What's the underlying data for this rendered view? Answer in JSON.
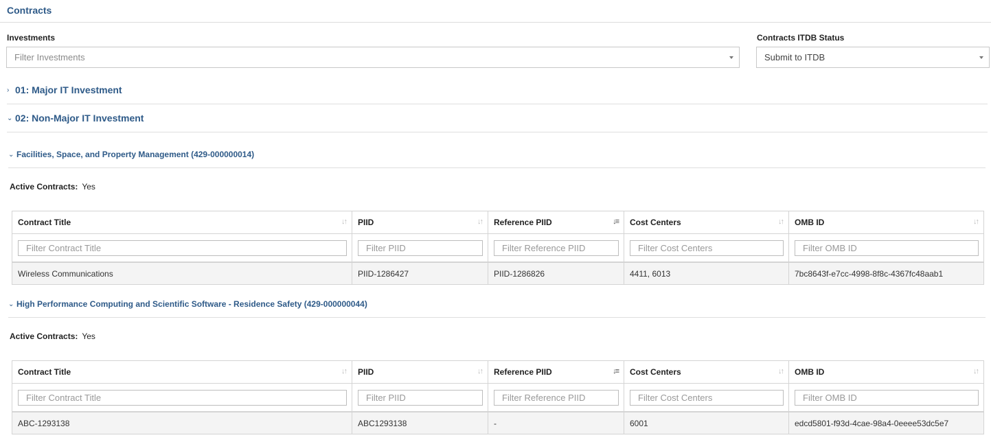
{
  "page": {
    "title": "Contracts"
  },
  "filters": {
    "investments_label": "Investments",
    "investments_placeholder": "Filter Investments",
    "status_label": "Contracts ITDB Status",
    "status_value": "Submit to ITDB"
  },
  "groups": [
    {
      "label": "01: Major IT Investment",
      "expanded": false
    },
    {
      "label": "02: Non-Major IT Investment",
      "expanded": true
    }
  ],
  "columns": [
    "Contract Title",
    "PIID",
    "Reference PIID",
    "Cost Centers",
    "OMB ID"
  ],
  "filter_placeholders": [
    "Filter Contract Title",
    "Filter PIID",
    "Filter Reference PIID",
    "Filter Cost Centers",
    "Filter OMB ID"
  ],
  "sections": [
    {
      "title": "Facilities, Space, and Property Management (429-000000014)",
      "active_label": "Active Contracts:",
      "active_value": "Yes",
      "row": [
        "Wireless Communications",
        "PIID-1286427",
        "PIID-1286826",
        "4411, 6013",
        "7bc8643f-e7cc-4998-8f8c-4367fc48aab1"
      ]
    },
    {
      "title": "High Performance Computing and Scientific Software - Residence Safety (429-000000044)",
      "active_label": "Active Contracts:",
      "active_value": "Yes",
      "row": [
        "ABC-1293138",
        "ABC1293138",
        "-",
        "6001",
        "edcd5801-f93d-4cae-98a4-0eeee53dc5e7"
      ]
    }
  ]
}
